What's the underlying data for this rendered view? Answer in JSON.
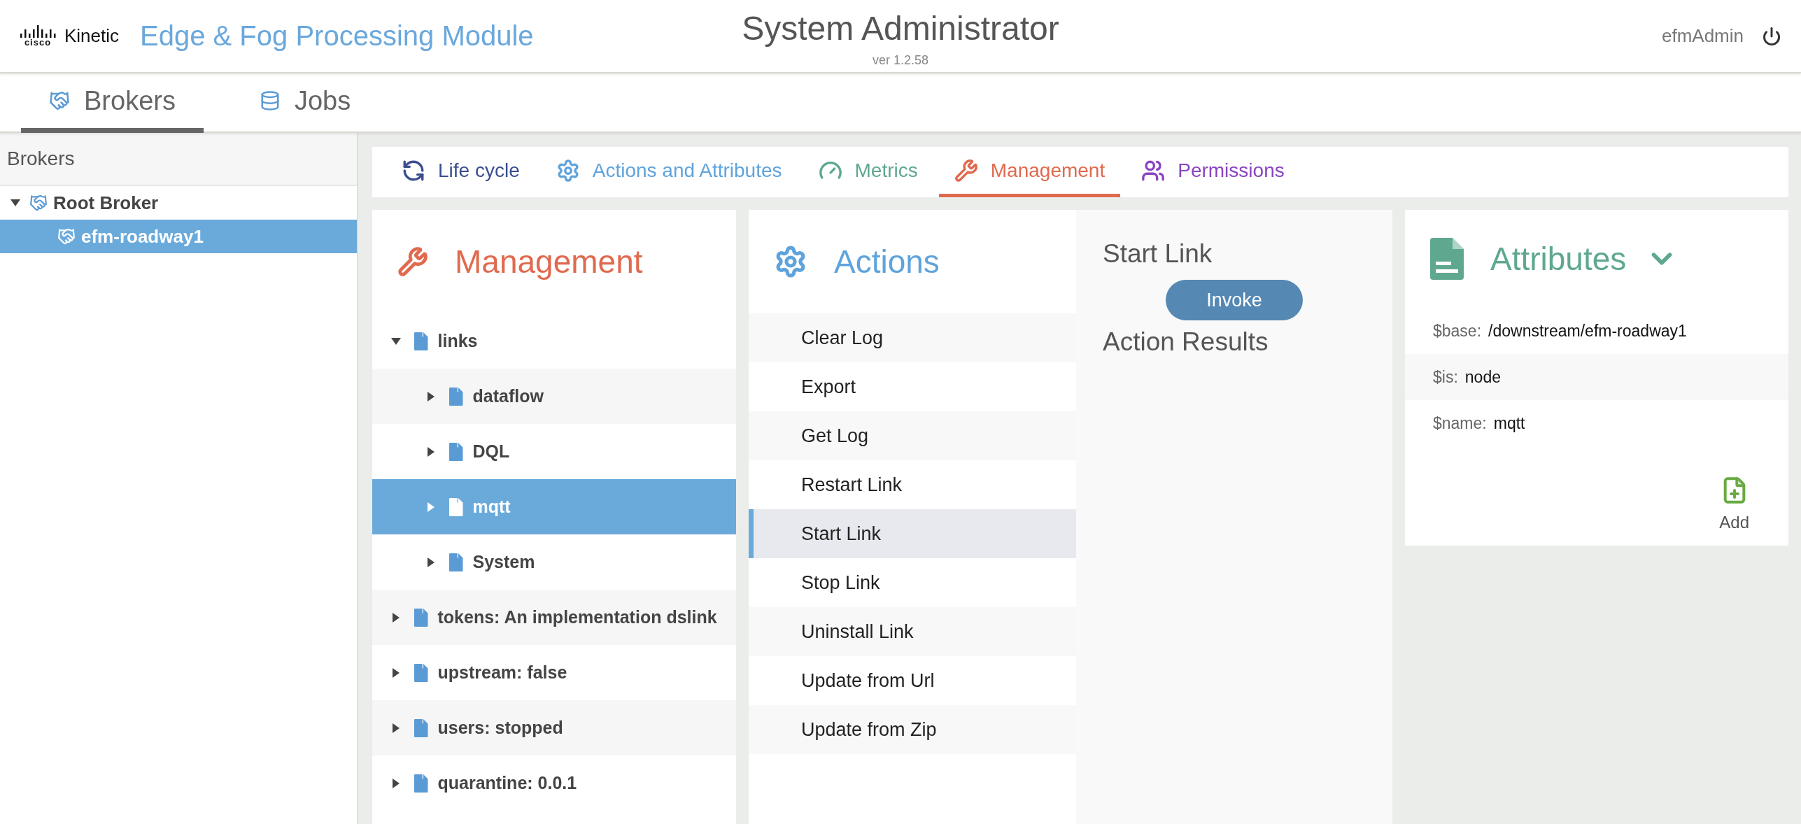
{
  "header": {
    "logo_wordmark": "cisco",
    "logo_text": "Kinetic",
    "app_title": "Edge & Fog Processing Module",
    "page_title": "System Administrator",
    "version": "ver 1.2.58",
    "user": "efmAdmin"
  },
  "nav_tabs": [
    {
      "label": "Brokers",
      "selected": true
    },
    {
      "label": "Jobs",
      "selected": false
    }
  ],
  "sidebar": {
    "title": "Brokers",
    "tree": [
      {
        "label": "Root Broker",
        "expanded": true,
        "selected": false,
        "children": [
          {
            "label": "efm-roadway1",
            "selected": true
          }
        ]
      }
    ]
  },
  "tabs": [
    {
      "label": "Life cycle",
      "color": "#3a4d8f",
      "selected": false
    },
    {
      "label": "Actions and Attributes",
      "color": "#5fa3dc",
      "selected": false
    },
    {
      "label": "Metrics",
      "color": "#5fa88f",
      "selected": false
    },
    {
      "label": "Management",
      "color": "#e06a4e",
      "selected": true
    },
    {
      "label": "Permissions",
      "color": "#8a45c0",
      "selected": false
    }
  ],
  "management": {
    "title": "Management",
    "tree": [
      {
        "label": "links",
        "expanded": true,
        "selected": false,
        "children": [
          {
            "label": "dataflow",
            "expanded": false,
            "selected": false
          },
          {
            "label": "DQL",
            "expanded": false,
            "selected": false
          },
          {
            "label": "mqtt",
            "expanded": false,
            "selected": true
          },
          {
            "label": "System",
            "expanded": false,
            "selected": false
          }
        ]
      },
      {
        "label": "tokens: An implementation dslink",
        "expanded": false,
        "selected": false
      },
      {
        "label": "upstream: false",
        "expanded": false,
        "selected": false
      },
      {
        "label": "users: stopped",
        "expanded": false,
        "selected": false
      },
      {
        "label": "quarantine: 0.0.1",
        "expanded": false,
        "selected": false
      }
    ]
  },
  "actions": {
    "title": "Actions",
    "items": [
      {
        "label": "Clear Log",
        "selected": false
      },
      {
        "label": "Export",
        "selected": false
      },
      {
        "label": "Get Log",
        "selected": false
      },
      {
        "label": "Restart Link",
        "selected": false
      },
      {
        "label": "Start Link",
        "selected": true
      },
      {
        "label": "Stop Link",
        "selected": false
      },
      {
        "label": "Uninstall Link",
        "selected": false
      },
      {
        "label": "Update from Url",
        "selected": false
      },
      {
        "label": "Update from Zip",
        "selected": false
      }
    ]
  },
  "action_detail": {
    "title": "Start Link",
    "button": "Invoke",
    "results_title": "Action Results"
  },
  "attributes": {
    "title": "Attributes",
    "rows": [
      {
        "key": "$base:",
        "value": "/downstream/efm-roadway1"
      },
      {
        "key": "$is:",
        "value": "node"
      },
      {
        "key": "$name:",
        "value": "mqtt"
      }
    ],
    "add_label": "Add"
  }
}
